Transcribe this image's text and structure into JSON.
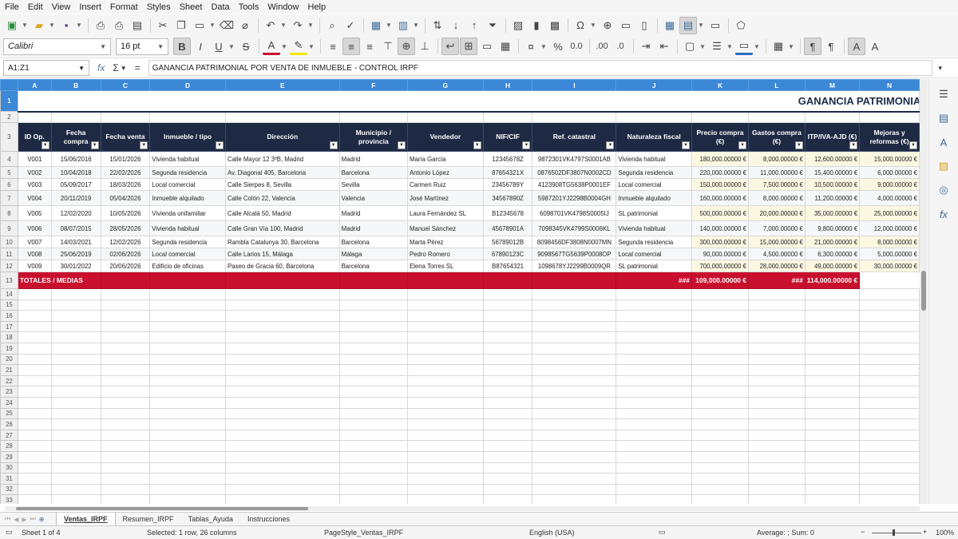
{
  "menu": [
    "File",
    "Edit",
    "View",
    "Insert",
    "Format",
    "Styles",
    "Sheet",
    "Data",
    "Tools",
    "Window",
    "Help"
  ],
  "toolbar": {
    "font_name": "Calibri",
    "font_size": "16 pt"
  },
  "formula_bar": {
    "name_box": "A1:Z1",
    "formula": "GANANCIA PATRIMONIAL POR VENTA DE INMUEBLE - CONTROL IRPF"
  },
  "sheet": {
    "columns": [
      "A",
      "B",
      "C",
      "D",
      "E",
      "F",
      "G",
      "H",
      "I",
      "J",
      "K",
      "L",
      "M",
      "N"
    ],
    "title": "GANANCIA PATRIMONIAL POR VENTA DE INMUEBLE - CONTROL IRPF",
    "headers": [
      "ID Op.",
      "Fecha compra",
      "Fecha venta",
      "Inmueble / tipo",
      "Dirección",
      "Municipio / provincia",
      "Vendedor",
      "NIF/CIF",
      "Ref. catastral",
      "Naturaleza fiscal",
      "Precio compra (€)",
      "Gastos compra (€)",
      "ITP/IVA-AJD (€)",
      "Mejoras y reformas (€)"
    ],
    "rows": [
      [
        "V001",
        "15/06/2016",
        "15/01/2026",
        "Vivienda habitual",
        "Calle Mayor 12 3ºB, Madrid",
        "Madrid",
        "María García",
        "12345678Z",
        "9872301VK4797S0001AB",
        "Vivienda habitual",
        "180,000.00000 €",
        "8,000.00000 €",
        "12,600.00000 €",
        "15,000.00000 €"
      ],
      [
        "V002",
        "10/04/2018",
        "22/02/2026",
        "Segunda residencia",
        "Av. Diagonal 405, Barcelona",
        "Barcelona",
        "Antonio López",
        "87654321X",
        "0876502DF3807N0002CD",
        "Segunda residencia",
        "220,000.00000 €",
        "11,000.00000 €",
        "15,400.00000 €",
        "6,000.00000 €"
      ],
      [
        "V003",
        "05/09/2017",
        "18/03/2026",
        "Local comercial",
        "Calle Sierpes 8, Sevilla",
        "Sevilla",
        "Carmen Ruiz",
        "23456789Y",
        "4123908TG5638P0001EF",
        "Local comercial",
        "150,000.00000 €",
        "7,500.00000 €",
        "10,500.00000 €",
        "9,000.00000 €"
      ],
      [
        "V004",
        "20/11/2019",
        "05/04/2026",
        "Inmueble alquilado",
        "Calle Colón 22, Valencia",
        "Valencia",
        "José Martínez",
        "34567890Z",
        "5987201YJ2298B0004GH",
        "Inmueble alquilado",
        "160,000.00000 €",
        "8,000.00000 €",
        "11,200.00000 €",
        "4,000.00000 €"
      ],
      [
        "V005",
        "12/02/2020",
        "10/05/2026",
        "Vivienda unifamiliar",
        "Calle Alcalá 50, Madrid",
        "Madrid",
        "Laura Fernández SL",
        "B12345678",
        "6098701VK4798S0005IJ",
        "SL patrimonial",
        "500,000.00000 €",
        "20,000.00000 €",
        "35,000.00000 €",
        "25,000.00000 €"
      ],
      [
        "V006",
        "08/07/2015",
        "28/05/2026",
        "Vivienda habitual",
        "Calle Gran Vía 100, Madrid",
        "Madrid",
        "Manuel Sánchez",
        "45678901A",
        "7098345VK4799S0006KL",
        "Vivienda habitual",
        "140,000.00000 €",
        "7,000.00000 €",
        "9,800.00000 €",
        "12,000.00000 €"
      ],
      [
        "V007",
        "14/03/2021",
        "12/02/2026",
        "Segunda residencia",
        "Rambla Catalunya 30, Barcelona",
        "Barcelona",
        "Marta Pérez",
        "56789012B",
        "8098456DF3808N0007MN",
        "Segunda residencia",
        "300,000.00000 €",
        "15,000.00000 €",
        "21,000.00000 €",
        "8,000.00000 €"
      ],
      [
        "V008",
        "25/06/2019",
        "02/06/2026",
        "Local comercial",
        "Calle Larios 15, Málaga",
        "Málaga",
        "Pedro Romero",
        "67890123C",
        "9098567TG5639P0008OP",
        "Local comercial",
        "90,000.00000 €",
        "4,500.00000 €",
        "6,300.00000 €",
        "5,000.00000 €"
      ],
      [
        "V009",
        "30/01/2022",
        "20/06/2026",
        "Edificio de oficinas",
        "Paseo de Gracia 60, Barcelona",
        "Barcelona",
        "Elena Torres SL",
        "B87654321",
        "1098678YJ2299B0009QR",
        "SL patrimonial",
        "700,000.00000 €",
        "28,000.00000 €",
        "49,000.00000 €",
        "30,000.00000 €"
      ]
    ],
    "totals": {
      "label": "TOTALES / MEDIAS",
      "k": "###",
      "l": "109,000.00000 €",
      "m": "###",
      "n": "114,000.00000 €"
    }
  },
  "tabs": [
    "Ventas_IRPF",
    "Resumen_IRPF",
    "Tablas_Ayuda",
    "Instrucciones"
  ],
  "status": {
    "sheet": "Sheet 1 of 4",
    "selection": "Selected: 1 row, 26 columns",
    "page_style": "PageStyle_Ventas_IRPF",
    "language": "English (USA)",
    "summary": "Average: ; Sum: 0",
    "zoom": "100%"
  }
}
